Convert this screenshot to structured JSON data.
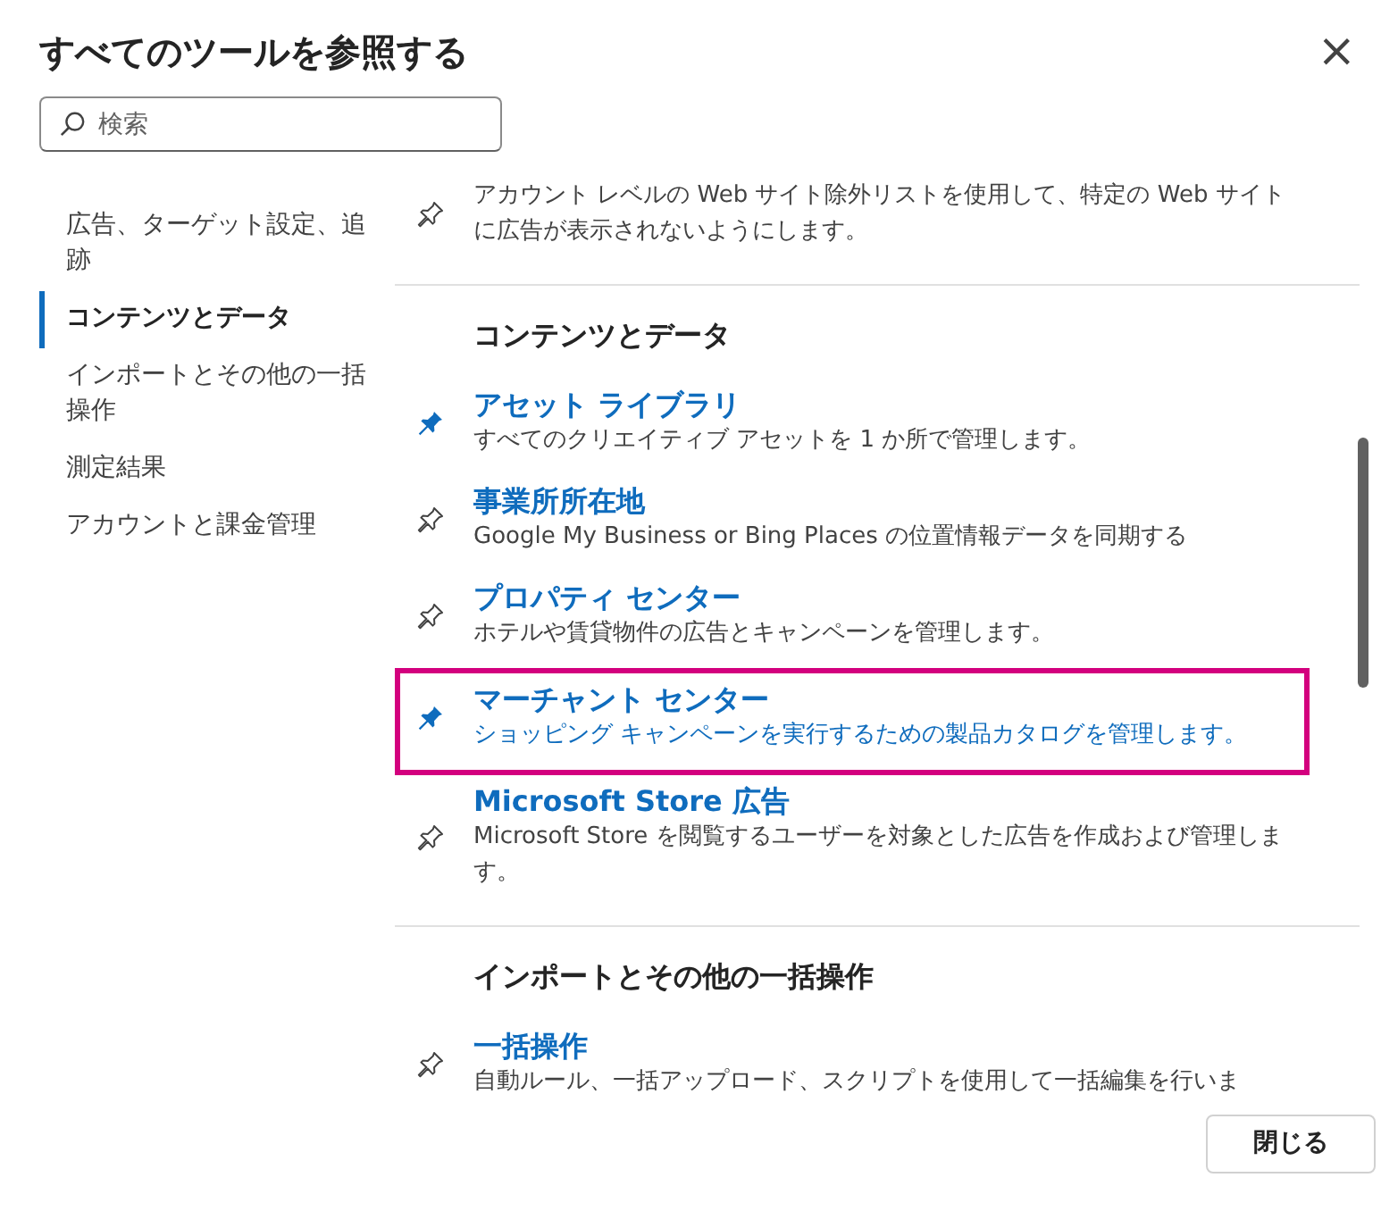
{
  "dialog": {
    "title": "すべてのツールを参照する",
    "close_label": "×"
  },
  "search": {
    "placeholder": "検索"
  },
  "nav": [
    {
      "label": "広告、ターゲット設定、追跡",
      "selected": false
    },
    {
      "label": "コンテンツとデータ",
      "selected": true
    },
    {
      "label": "インポートとその他の一括操作",
      "selected": false
    },
    {
      "label": "測定結果",
      "selected": false
    },
    {
      "label": "アカウントと課金管理",
      "selected": false
    }
  ],
  "sections": [
    {
      "items": [
        {
          "description": "アカウント レベルの Web サイト除外リストを使用して、特定の Web サイトに広告が表示されないようにします。",
          "pinned": false,
          "highlighted": false
        }
      ]
    },
    {
      "heading": "コンテンツとデータ",
      "items": [
        {
          "title": "アセット ライブラリ",
          "description": "すべてのクリエイティブ アセットを 1 か所で管理します。",
          "pinned": true,
          "highlighted": false
        },
        {
          "title": "事業所所在地",
          "description": "Google My Business or Bing Places の位置情報データを同期する",
          "pinned": false,
          "highlighted": false
        },
        {
          "title": "プロパティ センター",
          "description": "ホテルや賃貸物件の広告とキャンペーンを管理します。",
          "pinned": false,
          "highlighted": false
        },
        {
          "title": "マーチャント センター",
          "description": "ショッピング キャンペーンを実行するための製品カタログを管理します。",
          "pinned": true,
          "highlighted": true
        },
        {
          "title": "Microsoft Store 広告",
          "description": "Microsoft Store を閲覧するユーザーを対象とした広告を作成および管理します。",
          "pinned": false,
          "highlighted": false
        }
      ]
    },
    {
      "heading": "インポートとその他の一括操作",
      "items": [
        {
          "title": "一括操作",
          "description": "自動ルール、一括アップロード、スクリプトを使用して一括編集を行いま",
          "pinned": false,
          "highlighted": false
        }
      ]
    }
  ],
  "footer": {
    "close_button": "閉じる"
  }
}
